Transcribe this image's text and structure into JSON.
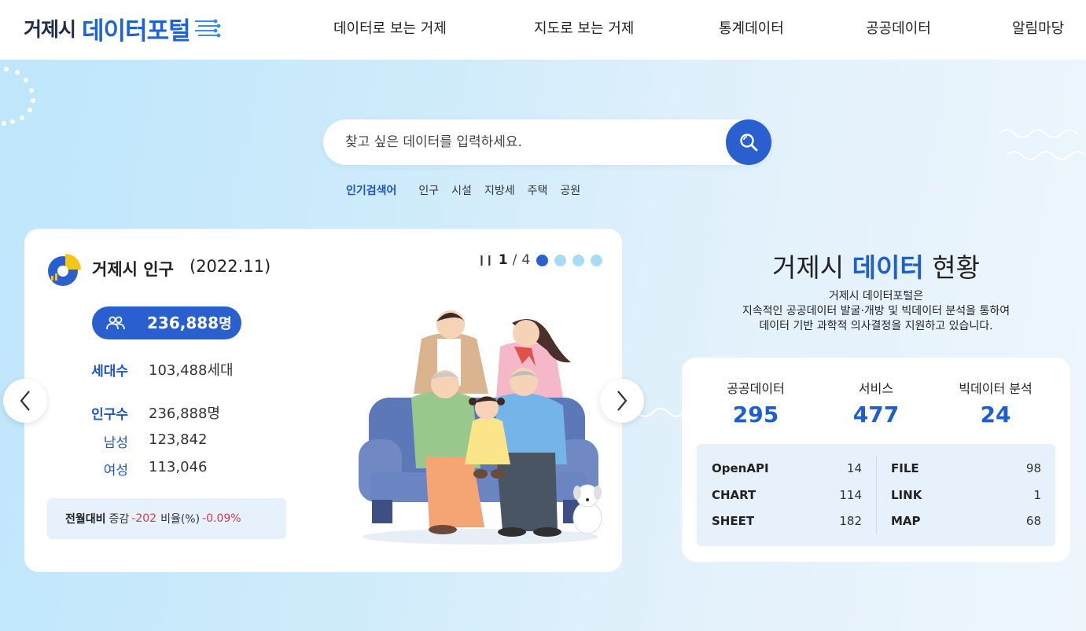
{
  "header": {
    "logo_part1": "거제시",
    "logo_part2": "데이터포털",
    "nav": [
      "데이터로 보는 거제",
      "지도로 보는 거제",
      "통계데이터",
      "공공데이터",
      "알림마당"
    ]
  },
  "search": {
    "placeholder": "찾고 싶은 데이터를 입력하세요.",
    "popular_title": "인기검색어",
    "keywords": [
      "인구",
      "시설",
      "지방세",
      "주택",
      "공원"
    ]
  },
  "population_card": {
    "title": "거제시 인구",
    "date": "(2022.11)",
    "pager": {
      "current": "1",
      "separator": "/",
      "total": "4"
    },
    "total_population": "236,888",
    "total_unit": "명",
    "households_label": "세대수",
    "households_value": "103,488세대",
    "population_label": "인구수",
    "population_value": "236,888명",
    "male_label": "남성",
    "male_value": "123,842",
    "female_label": "여성",
    "female_value": "113,046",
    "change": {
      "title": "전월대비",
      "increase_label": "증감",
      "increase_value": "-202",
      "ratio_label": "비율(%)",
      "ratio_value": "-0.09%"
    }
  },
  "status": {
    "title_pre": "거제시",
    "title_highlight": "데이터",
    "title_post": "현황",
    "desc_line1": "거제시 데이터포털은",
    "desc_line2": "지속적인 공공데이터 발굴·개방 및 빅데이터 분석을 통하여",
    "desc_line3": "데이터 기반 과학적 의사결정을 지원하고 있습니다.",
    "stats": [
      {
        "label": "공공데이터",
        "value": "295"
      },
      {
        "label": "서비스",
        "value": "477"
      },
      {
        "label": "빅데이터 분석",
        "value": "24"
      }
    ],
    "types_left": [
      {
        "name": "OpenAPI",
        "count": "14"
      },
      {
        "name": "CHART",
        "count": "114"
      },
      {
        "name": "SHEET",
        "count": "182"
      }
    ],
    "types_right": [
      {
        "name": "FILE",
        "count": "98"
      },
      {
        "name": "LINK",
        "count": "1"
      },
      {
        "name": "MAP",
        "count": "68"
      }
    ]
  },
  "colors": {
    "accent": "#2a5fd0",
    "negative": "#d63a4a",
    "light_bg": "#e6f1fb"
  }
}
